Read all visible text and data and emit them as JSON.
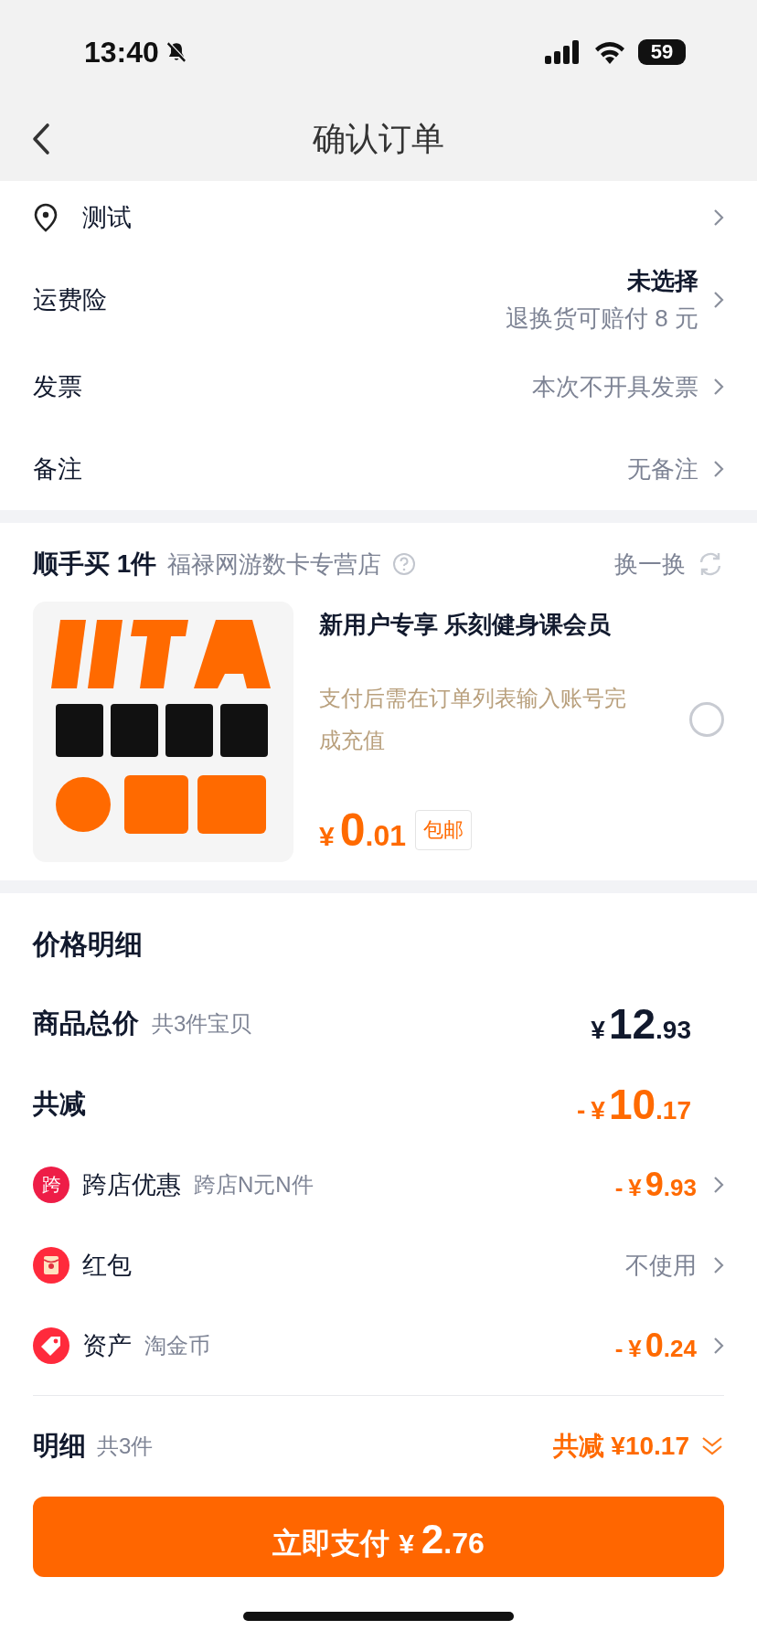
{
  "status_bar": {
    "time": "13:40",
    "battery": "59"
  },
  "nav": {
    "title": "确认订单"
  },
  "order_rows": [
    {
      "kind": "address",
      "label": "测试"
    },
    {
      "kind": "option_with_note",
      "label": "运费险",
      "value": "未选择",
      "note": "退换货可赔付 8 元"
    },
    {
      "kind": "option",
      "label": "发票",
      "value": "本次不开具发票"
    },
    {
      "kind": "option",
      "label": "备注",
      "value": "无备注"
    }
  ],
  "add_on": {
    "title": "顺手买 1件",
    "store": "福禄网游数卡专营店",
    "swap": "换一换",
    "product": {
      "name": "新用户专享 乐刻健身课会员",
      "notice": "支付后需在订单列表输入账号完成充值",
      "price": {
        "currency": "¥",
        "integer": "0",
        "decimal": ".01"
      },
      "tag": "包邮",
      "selected": false
    }
  },
  "price_detail": {
    "title": "价格明细",
    "rows": [
      {
        "kind": "total",
        "label": "商品总价",
        "sub": "共3件宝贝",
        "price": {
          "currency": "¥",
          "integer": "12",
          "decimal": ".93"
        },
        "arrow": false
      },
      {
        "kind": "total",
        "label": "共减",
        "price": {
          "sign": "-",
          "currency": "¥",
          "integer": "10",
          "decimal": ".17"
        },
        "arrow": false
      },
      {
        "kind": "cross_store",
        "badge": "跨",
        "label": "跨店优惠",
        "sub": "跨店N元N件",
        "price": {
          "sign": "-",
          "currency": "¥",
          "integer": "9",
          "decimal": ".93"
        },
        "arrow": true
      },
      {
        "kind": "red_packet",
        "label": "红包",
        "value": "不使用",
        "arrow": true
      },
      {
        "kind": "asset",
        "label": "资产",
        "sub": "淘金币",
        "price": {
          "sign": "-",
          "currency": "¥",
          "integer": "0",
          "decimal": ".24"
        },
        "arrow": true
      }
    ]
  },
  "summary": {
    "label": "明细",
    "sub": "共3件",
    "discount": "共减 ¥10.17",
    "expanded": false
  },
  "pay_button": {
    "label": "立即支付",
    "price": {
      "currency": "¥",
      "integer": "2",
      "decimal": ".76"
    }
  }
}
